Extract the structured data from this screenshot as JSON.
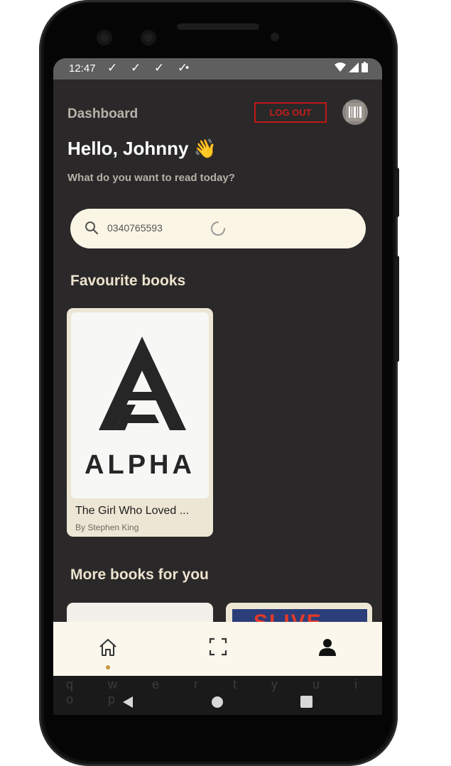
{
  "status_bar": {
    "time": "12:47",
    "notification_icons": "✓ ✓ ✓ ✓",
    "dot": "•"
  },
  "header": {
    "title": "Dashboard",
    "logout_label": "LOG OUT"
  },
  "greeting": {
    "title": "Hello, Johnny 👋",
    "subtitle": "What do you want to read today?"
  },
  "search": {
    "value": "0340765593"
  },
  "favourites": {
    "heading": "Favourite books",
    "books": [
      {
        "cover_text": "ALPHA",
        "title": "The Girl Who Loved ...",
        "author": "By Stephen King"
      }
    ]
  },
  "more_books": {
    "heading": "More books for you",
    "second_cover_text": "SLIVE"
  },
  "bottom_nav": {
    "items": [
      "home-icon",
      "scan-icon",
      "profile-icon"
    ],
    "active": "home"
  },
  "keyboard_row": "q w e r t y u i o p",
  "colors": {
    "accent_red": "#c41e1e",
    "background": "#2a2828",
    "cream": "#fbf5e5"
  }
}
